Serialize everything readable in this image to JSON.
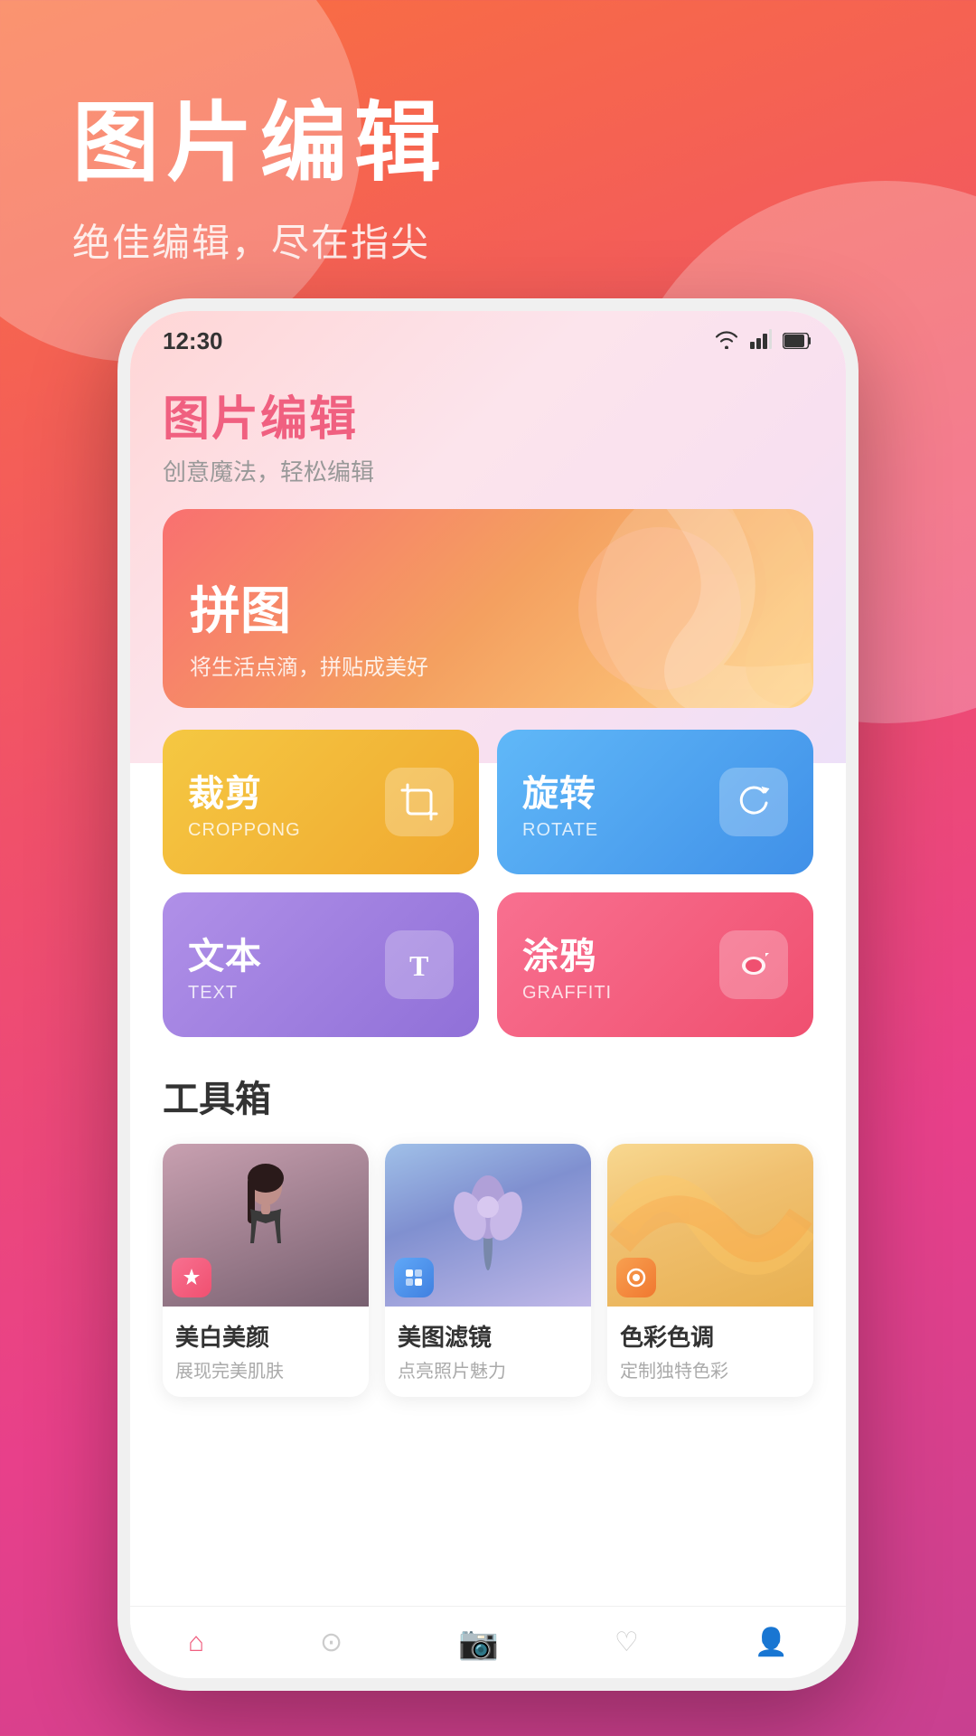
{
  "background": {
    "gradient_start": "#f97040",
    "gradient_end": "#c84090"
  },
  "page_header": {
    "title": "图片编辑",
    "subtitle": "绝佳编辑，尽在指尖"
  },
  "status_bar": {
    "time": "12:30"
  },
  "app_header": {
    "title": "图片编辑",
    "subtitle": "创意魔法，轻松编辑"
  },
  "banner": {
    "title": "拼图",
    "subtitle": "将生活点滴，拼贴成美好"
  },
  "tools": [
    {
      "name": "裁剪",
      "name_en": "CROPPONG",
      "icon": "✂",
      "color_class": "tool-card-yellow"
    },
    {
      "name": "旋转",
      "name_en": "ROTATE",
      "icon": "↻",
      "color_class": "tool-card-blue"
    },
    {
      "name": "文本",
      "name_en": "TEXT",
      "icon": "T",
      "color_class": "tool-card-purple"
    },
    {
      "name": "涂鸦",
      "name_en": "GRAFFITI",
      "icon": "✏",
      "color_class": "tool-card-pink"
    }
  ],
  "toolbox": {
    "section_title": "工具箱",
    "items": [
      {
        "title": "美白美颜",
        "desc": "展现完美肌肤",
        "icon": "✨",
        "icon_class": "icon-pink"
      },
      {
        "title": "美图滤镜",
        "desc": "点亮照片魅力",
        "icon": "▣",
        "icon_class": "icon-blue"
      },
      {
        "title": "色彩色调",
        "desc": "定制独特色彩",
        "icon": "◉",
        "icon_class": "icon-orange"
      }
    ]
  }
}
